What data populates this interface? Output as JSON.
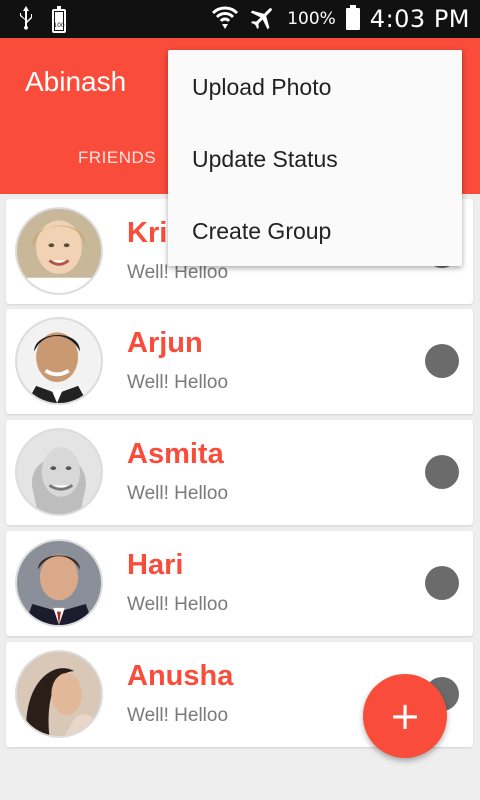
{
  "status_bar": {
    "battery_small_label": "100",
    "battery_percent": "100%",
    "time": "4:03 PM",
    "icons": [
      "usb-icon",
      "battery-100-icon",
      "wifi-icon",
      "airplane-icon",
      "battery-icon"
    ]
  },
  "app_bar": {
    "title": "Abinash",
    "tab_friends": "FRIENDS",
    "color": "#f94c3b"
  },
  "menu": {
    "items": [
      "Upload Photo",
      "Update Status",
      "Create Group"
    ]
  },
  "contacts": [
    {
      "name": "Kris",
      "message": "Well! Helloo"
    },
    {
      "name": "Arjun",
      "message": "Well! Helloo"
    },
    {
      "name": "Asmita",
      "message": "Well! Helloo"
    },
    {
      "name": "Hari",
      "message": "Well! Helloo"
    },
    {
      "name": "Anusha",
      "message": "Well! Helloo"
    }
  ],
  "fab": {
    "label": "+",
    "icon": "add-icon"
  },
  "colors": {
    "accent": "#f94c3b",
    "status_dot": "#6b6b6b",
    "message": "#7a7a7a"
  }
}
